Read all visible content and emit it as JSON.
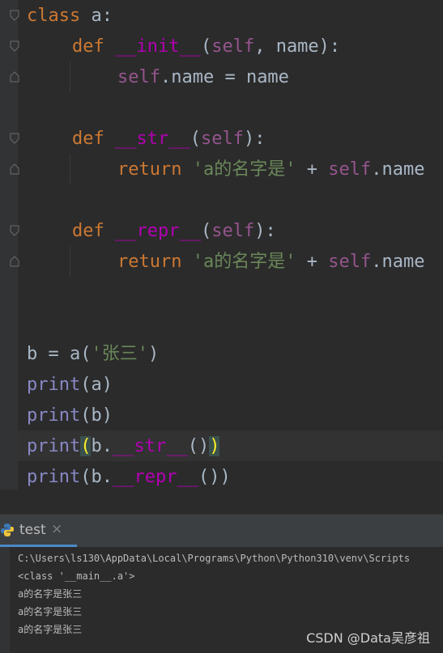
{
  "editor": {
    "lines": {
      "l1": {
        "kw": "class",
        "name": "a:"
      },
      "l2": {
        "kw": "def",
        "fn": "__init__",
        "open": "(",
        "self": "self",
        "rest": ", name):"
      },
      "l3": {
        "self": "self",
        ".name = name": ".name = name"
      },
      "l5": {
        "kw": "def",
        "fn": "__str__",
        "open": "(",
        "self": "self",
        "rest": "):"
      },
      "l6": {
        "kw": "return",
        "str": "'a的名字是'",
        "plus": " + ",
        "self": "self",
        "rest": ".name"
      },
      "l8": {
        "kw": "def",
        "fn": "__repr__",
        "open": "(",
        "self": "self",
        "rest": "):"
      },
      "l9": {
        "kw": "return",
        "str": "'a的名字是'",
        "plus": " + ",
        "self": "self",
        "rest": ".name"
      },
      "l12": {
        "pre": "b = a(",
        "str": "'张三'",
        "post": ")"
      },
      "l13": {
        "bi": "print",
        "rest": "(a)"
      },
      "l14": {
        "bi": "print",
        "rest": "(b)"
      },
      "l15": {
        "bi": "print",
        "open": "(",
        "pre": "b.",
        "fn": "__str__",
        "mid": "()",
        "close": ")"
      },
      "l16": {
        "bi": "print",
        "pre": "(b.",
        "fn": "__repr__",
        "post": "())"
      }
    }
  },
  "run_panel": {
    "tab_label": "test",
    "close_glyph": "×",
    "output": [
      "C:\\Users\\ls130\\AppData\\Local\\Programs\\Python\\Python310\\venv\\Scripts",
      "<class '__main__.a'>",
      "a的名字是张三",
      "a的名字是张三",
      "a的名字是张三"
    ]
  },
  "watermark": "CSDN @Data吴彦祖",
  "colors": {
    "keyword": "#cc7832",
    "magic": "#b200b2",
    "self": "#94558d",
    "string": "#6a8759",
    "builtin": "#8888c6",
    "text": "#a9b7c6",
    "background": "#2b2b2b",
    "tab_accent": "#4a88c7"
  }
}
